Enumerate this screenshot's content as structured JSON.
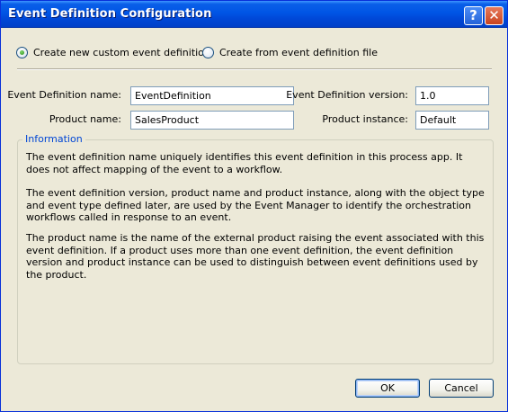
{
  "window": {
    "title": "Event Definition Configuration",
    "help_label": "?",
    "close_label": "✕"
  },
  "mode": {
    "option_new": "Create new custom event definition",
    "option_file": "Create from event definition file",
    "selected": "new"
  },
  "form": {
    "event_name_label": "Event Definition name:",
    "event_name_value": "EventDefinition",
    "event_version_label": "Event Definition version:",
    "event_version_value": "1.0",
    "product_name_label": "Product name:",
    "product_name_value": "SalesProduct",
    "product_instance_label": "Product instance:",
    "product_instance_value": "Default"
  },
  "information": {
    "title": "Information",
    "paragraphs": [
      "The event definition name uniquely identifies this event definition in this process app.  It does not affect mapping of the event to a workflow.",
      "The event definition version, product name and product instance, along with the object type and event type defined later, are used by the Event Manager to identify the orchestration workflows called in response to an event.",
      "The product name is the name of the external product raising the event associated with this event definition. If a product uses more than one event definition, the event definition version and product instance can be used to distinguish between event definitions used by the product."
    ]
  },
  "buttons": {
    "ok_label": "OK",
    "cancel_label": "Cancel"
  },
  "colors": {
    "title_bar": "#0055E5",
    "dialog_bg": "#ECE9D8",
    "group_title": "#0046D5",
    "field_border": "#7F9DB9"
  }
}
